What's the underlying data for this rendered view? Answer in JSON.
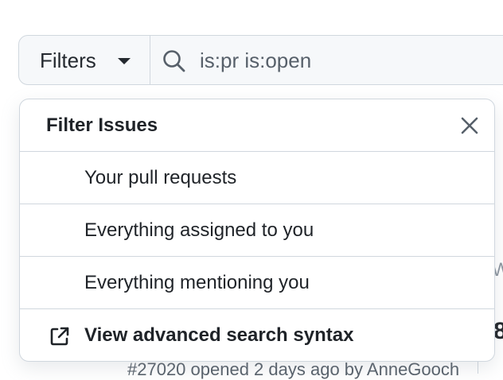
{
  "filters": {
    "button_label": "Filters",
    "search_value": "is:pr is:open"
  },
  "menu": {
    "title": "Filter Issues",
    "items": [
      {
        "label": "Your pull requests"
      },
      {
        "label": "Everything assigned to you"
      },
      {
        "label": "Everything mentioning you"
      },
      {
        "label": "View advanced search syntax",
        "icon": "link-external-icon"
      }
    ]
  },
  "background": {
    "fragment_1": "Wo",
    "fragment_2": "8",
    "meta_text": "#27020 opened 2 days ago by AnneGooch"
  },
  "colors": {
    "border": "#d0d7de",
    "bar_bg": "#f6f8fa",
    "text": "#1f2328",
    "muted": "#57606a"
  }
}
